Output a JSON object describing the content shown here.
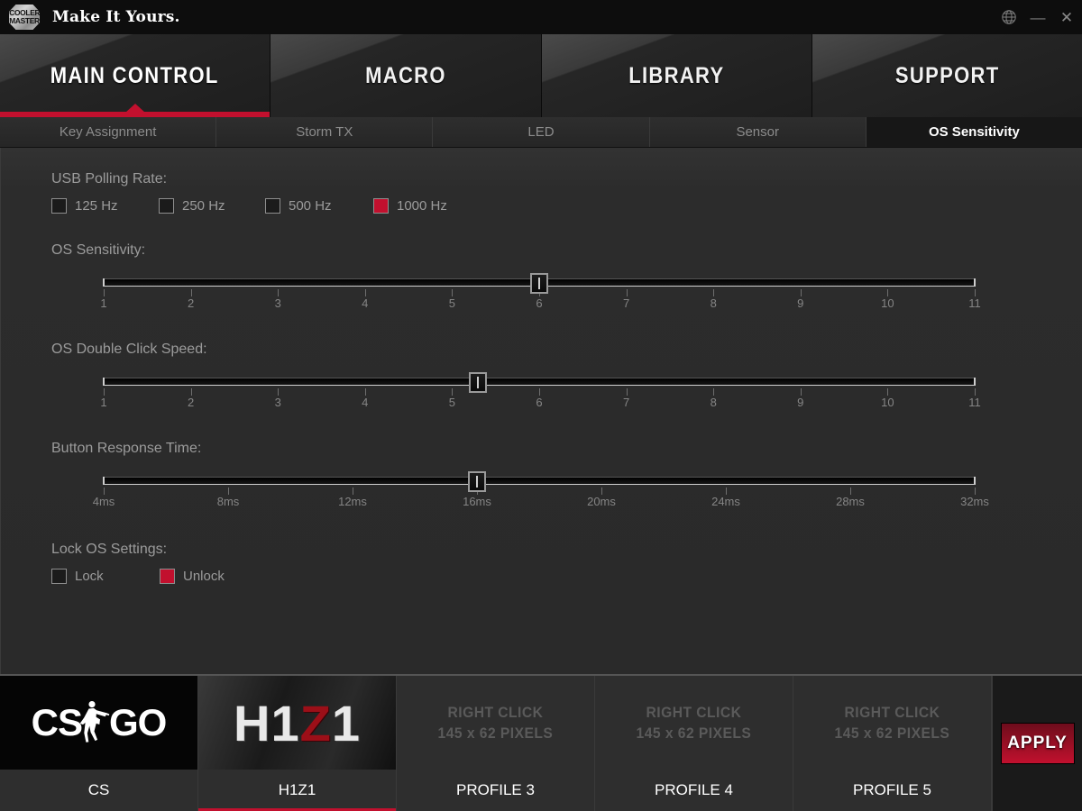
{
  "titlebar": {
    "logo_line1": "COOLER",
    "logo_line2": "MASTER",
    "tagline": "Make It Yours.",
    "globe_icon": "globe-icon",
    "minimize_label": "—",
    "close_label": "✕"
  },
  "main_tabs": [
    {
      "label": "MAIN CONTROL",
      "active": true
    },
    {
      "label": "MACRO",
      "active": false
    },
    {
      "label": "LIBRARY",
      "active": false
    },
    {
      "label": "SUPPORT",
      "active": false
    }
  ],
  "sub_tabs": [
    {
      "label": "Key Assignment",
      "active": false
    },
    {
      "label": "Storm TX",
      "active": false
    },
    {
      "label": "LED",
      "active": false
    },
    {
      "label": "Sensor",
      "active": false
    },
    {
      "label": "OS Sensitivity",
      "active": true
    }
  ],
  "polling": {
    "label": "USB Polling Rate:",
    "options": [
      {
        "label": "125 Hz",
        "checked": false
      },
      {
        "label": "250 Hz",
        "checked": false
      },
      {
        "label": "500 Hz",
        "checked": false
      },
      {
        "label": "1000 Hz",
        "checked": true
      }
    ]
  },
  "os_sensitivity": {
    "label": "OS Sensitivity:",
    "ticks": [
      "1",
      "2",
      "3",
      "4",
      "5",
      "6",
      "7",
      "8",
      "9",
      "10",
      "11"
    ],
    "value": 6,
    "min": 1,
    "max": 11
  },
  "double_click": {
    "label": "OS Double Click Speed:",
    "ticks": [
      "1",
      "2",
      "3",
      "4",
      "5",
      "6",
      "7",
      "8",
      "9",
      "10",
      "11"
    ],
    "value": 5.3,
    "min": 1,
    "max": 11
  },
  "response_time": {
    "label": "Button Response Time:",
    "ticks": [
      "4ms",
      "8ms",
      "12ms",
      "16ms",
      "20ms",
      "24ms",
      "28ms",
      "32ms"
    ],
    "value": 16,
    "min": 4,
    "max": 32,
    "step": 4
  },
  "lock": {
    "label": "Lock OS Settings:",
    "options": [
      {
        "label": "Lock",
        "checked": false
      },
      {
        "label": "Unlock",
        "checked": true
      }
    ]
  },
  "profiles": [
    {
      "name": "CS",
      "type": "csgo",
      "active": false,
      "placeholder_line1": "",
      "placeholder_line2": ""
    },
    {
      "name": "H1Z1",
      "type": "h1z1",
      "active": true,
      "placeholder_line1": "",
      "placeholder_line2": ""
    },
    {
      "name": "PROFILE 3",
      "type": "empty",
      "active": false,
      "placeholder_line1": "RIGHT CLICK",
      "placeholder_line2": "145 x 62 PIXELS"
    },
    {
      "name": "PROFILE 4",
      "type": "empty",
      "active": false,
      "placeholder_line1": "RIGHT CLICK",
      "placeholder_line2": "145 x 62 PIXELS"
    },
    {
      "name": "PROFILE 5",
      "type": "empty",
      "active": false,
      "placeholder_line1": "RIGHT CLICK",
      "placeholder_line2": "145 x 62 PIXELS"
    }
  ],
  "apply": {
    "label": "APPLY"
  },
  "colors": {
    "accent_red": "#c2102e",
    "panel_bg": "#2a2a2a",
    "titlebar_bg": "#0d0d0d",
    "label_gray": "#9b9b9b"
  }
}
